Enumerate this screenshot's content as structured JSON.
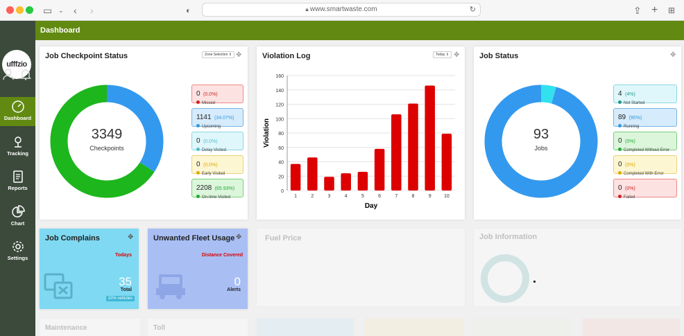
{
  "browser": {
    "url": "www.smartwaste.com"
  },
  "header": {
    "title": "Dashboard"
  },
  "logo": "ufffzio",
  "nav": [
    {
      "label": "Dashboard",
      "icon": "dashboard-gauge-icon"
    },
    {
      "label": "Tracking",
      "icon": "tracking-pin-icon"
    },
    {
      "label": "Reports",
      "icon": "reports-document-icon"
    },
    {
      "label": "Chart",
      "icon": "pie-chart-icon"
    },
    {
      "label": "Settings",
      "icon": "gear-icon"
    }
  ],
  "checkpoint": {
    "title": "Job Checkpoint Status",
    "select": "Zone Selection",
    "total": "3349",
    "total_label": "Checkpoints",
    "stats": [
      {
        "value": "0",
        "pct": "(0.0%)",
        "label": "Missed",
        "color": "#cc2222"
      },
      {
        "value": "1141",
        "pct": "(34.07%)",
        "label": "Upcoming",
        "color": "#3399dd"
      },
      {
        "value": "0",
        "pct": "(0.0%)",
        "label": "Delay Visited",
        "color": "#55bbcc"
      },
      {
        "value": "0",
        "pct": "(0.0%)",
        "label": "Early Visited",
        "color": "#ddaa00"
      },
      {
        "value": "2208",
        "pct": "(65.93%)",
        "label": "On-time Visited",
        "color": "#22aa33"
      }
    ],
    "donut": [
      {
        "value": 1141,
        "color": "#3399ee"
      },
      {
        "value": 2208,
        "color": "#1db61d"
      }
    ]
  },
  "violation": {
    "title": "Violation Log",
    "select": "Today"
  },
  "chart_data": {
    "type": "bar",
    "categories": [
      "1",
      "2",
      "3",
      "4",
      "5",
      "6",
      "7",
      "8",
      "9",
      "10"
    ],
    "values": [
      37,
      46,
      19,
      24,
      26,
      58,
      106,
      121,
      146,
      79
    ],
    "xlabel": "Day",
    "ylabel": "Violation",
    "ylim": [
      0,
      160
    ],
    "yticks": [
      0,
      20,
      40,
      60,
      80,
      100,
      120,
      140,
      160
    ],
    "grid": true,
    "color": "#dd0000"
  },
  "jobstatus": {
    "title": "Job Status",
    "total": "93",
    "total_label": "Jobs",
    "stats": [
      {
        "value": "4",
        "pct": "(4%)",
        "label": "Not Started",
        "color": "#229988"
      },
      {
        "value": "89",
        "pct": "(95%)",
        "label": "Running",
        "color": "#3399dd"
      },
      {
        "value": "0",
        "pct": "(0%)",
        "label": "Completed Without Error",
        "color": "#22aa33"
      },
      {
        "value": "0",
        "pct": "(0%)",
        "label": "Completed With Error",
        "color": "#ddaa00"
      },
      {
        "value": "0",
        "pct": "(0%)",
        "label": "Failed",
        "color": "#cc2222"
      }
    ],
    "donut": [
      {
        "value": 4,
        "color": "#33e0ee"
      },
      {
        "value": 89,
        "color": "#3399ee"
      }
    ]
  },
  "complains": {
    "title": "Job Complains",
    "period": "Todays",
    "value": "35",
    "value_label": "Total",
    "badge": "10% vehicles"
  },
  "fleet": {
    "title": "Unwanted Fleet Usage",
    "subtitle": "Distance Covered",
    "value": "0",
    "value_label": "Alerts"
  },
  "faded": {
    "fuel": "Fuel Price",
    "jobinfo": "Job Information",
    "maintenance": "Maintenance",
    "toll": "Toll"
  }
}
